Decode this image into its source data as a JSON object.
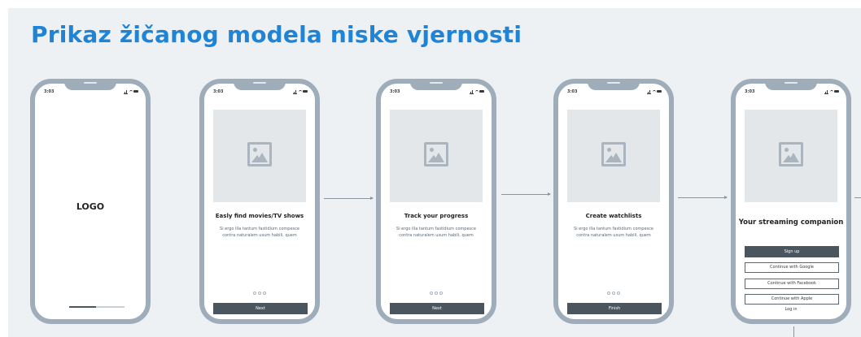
{
  "title": "Prikaz žičanog modela niske vjernosti",
  "status_time": "3:03",
  "splash": {
    "logo": "LOGO"
  },
  "onboarding": [
    {
      "heading": "Easly find movies/TV shows",
      "body": "Si ergo illa tantum fastidium compesce contra naturalem usum habili, quem",
      "button": "Next"
    },
    {
      "heading": "Track your progress",
      "body": "Si ergo illa tantum fastidium compesce contra naturalem usum habili, quem",
      "button": "Next"
    },
    {
      "heading": "Create watchlists",
      "body": "Si ergo illa tantum fastidium compesce contra naturalem usum habili, quem",
      "button": "Finish"
    }
  ],
  "signup_screen": {
    "heading": "Your streaming companion",
    "sign_up": "Sign up",
    "google": "Continue with Google",
    "facebook": "Continue with Facebook",
    "apple": "Continue with Apple",
    "login": "Log in"
  },
  "colors": {
    "title": "#1f84d6",
    "phone_frame": "#9fadbb",
    "primary_button": "#4a555e",
    "background": "#eef1f4"
  },
  "icons": [
    "image-placeholder-icon",
    "signal-icon",
    "wifi-icon",
    "battery-icon"
  ]
}
